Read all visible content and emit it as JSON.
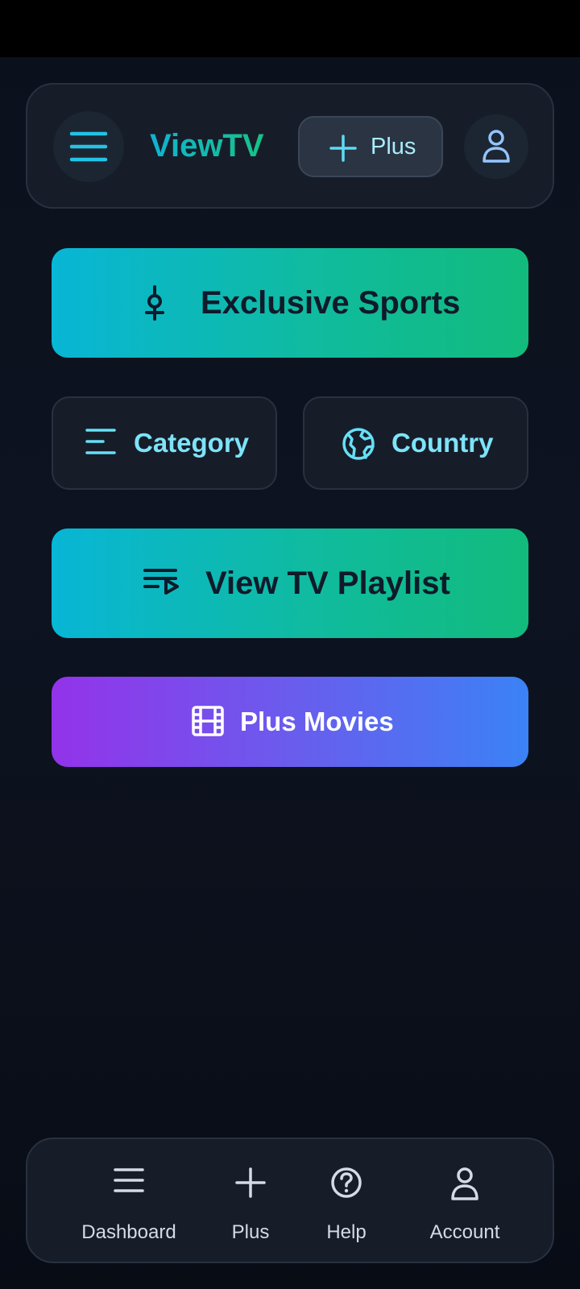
{
  "header": {
    "brand": "ViewTV",
    "plus_label": "Plus",
    "icons": [
      "menu-icon",
      "plus-icon",
      "user-icon"
    ]
  },
  "main": {
    "sports_label": "Exclusive Sports",
    "category_label": "Category",
    "country_label": "Country",
    "playlist_label": "View TV Playlist",
    "movies_label": "Plus Movies"
  },
  "bottom_nav": {
    "items": [
      {
        "label": "Dashboard",
        "icon": "menu-icon"
      },
      {
        "label": "Plus",
        "icon": "plus-icon"
      },
      {
        "label": "Help",
        "icon": "help-circle-icon"
      },
      {
        "label": "Account",
        "icon": "user-icon"
      }
    ]
  },
  "colors": {
    "accent_cyan": "#06b6d4",
    "accent_green": "#10b981",
    "purple": "#9333ea",
    "blue": "#3b82f6",
    "background": "#0d1320"
  }
}
